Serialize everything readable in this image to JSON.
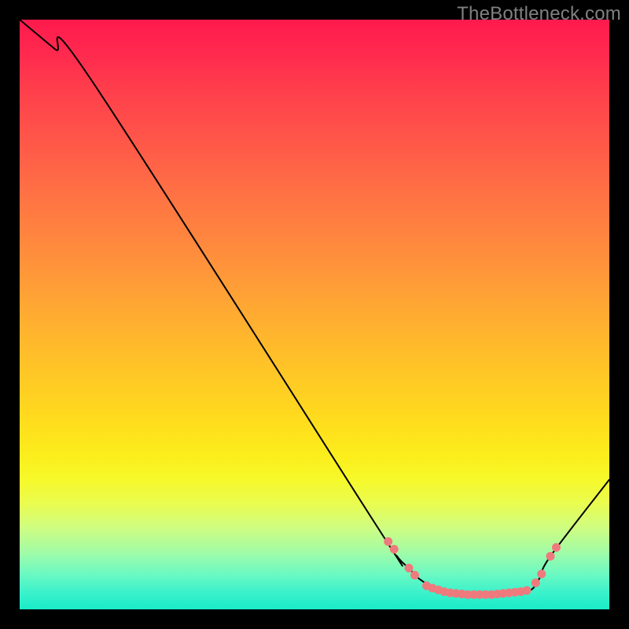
{
  "watermark": "TheBottleneck.com",
  "chart_data": {
    "type": "line",
    "title": "",
    "xlabel": "",
    "ylabel": "",
    "xlim": [
      0,
      100
    ],
    "ylim": [
      0,
      100
    ],
    "series": [
      {
        "name": "curve",
        "x": [
          0,
          6,
          12,
          60,
          64,
          66,
          68,
          72,
          80,
          86,
          88,
          90,
          100
        ],
        "values": [
          100,
          95,
          90,
          15,
          9,
          7,
          5,
          3,
          2.5,
          3,
          5,
          9,
          22
        ]
      }
    ],
    "marker_groups": [
      {
        "name": "left-descent-markers",
        "color": "#ef7a7d",
        "points": [
          {
            "x": 62.5,
            "y": 11.5
          },
          {
            "x": 63.5,
            "y": 10.2
          },
          {
            "x": 66.0,
            "y": 7.0
          },
          {
            "x": 67.0,
            "y": 5.8
          }
        ]
      },
      {
        "name": "valley-markers",
        "color": "#ef7a7d",
        "points": [
          {
            "x": 69.0,
            "y": 4.0
          },
          {
            "x": 70.0,
            "y": 3.6
          },
          {
            "x": 71.0,
            "y": 3.3
          },
          {
            "x": 72.0,
            "y": 3.0
          },
          {
            "x": 73.0,
            "y": 2.8
          },
          {
            "x": 74.0,
            "y": 2.7
          },
          {
            "x": 75.0,
            "y": 2.6
          },
          {
            "x": 76.0,
            "y": 2.5
          },
          {
            "x": 77.0,
            "y": 2.5
          },
          {
            "x": 78.0,
            "y": 2.5
          },
          {
            "x": 79.0,
            "y": 2.5
          },
          {
            "x": 80.0,
            "y": 2.5
          },
          {
            "x": 81.0,
            "y": 2.6
          },
          {
            "x": 82.0,
            "y": 2.7
          },
          {
            "x": 83.0,
            "y": 2.8
          },
          {
            "x": 84.0,
            "y": 2.9
          },
          {
            "x": 85.0,
            "y": 3.0
          },
          {
            "x": 86.0,
            "y": 3.2
          }
        ]
      },
      {
        "name": "right-rise-markers",
        "color": "#ef7a7d",
        "points": [
          {
            "x": 87.5,
            "y": 4.5
          },
          {
            "x": 88.5,
            "y": 6.0
          },
          {
            "x": 90.0,
            "y": 9.0
          },
          {
            "x": 91.0,
            "y": 10.5
          }
        ]
      }
    ],
    "background_gradient": {
      "top": "#ff1a4d",
      "mid": "#ffdc1d",
      "bottom": "#1aecc9"
    }
  }
}
